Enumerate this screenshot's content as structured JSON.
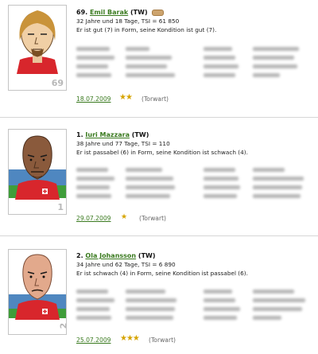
{
  "players": [
    {
      "rank": "69.",
      "name": "Emil Barak",
      "position_code": "(TW)",
      "age_tsi": "32 Jahre und 18 Tage, TSI = 61 850",
      "form_text": "Er ist gut (7) in Form, seine Kondition ist gut (7).",
      "shirt_number": "69",
      "date": "18.07.2009",
      "stars_icon": "star-rating-icon",
      "position_label": "(Torwart)"
    },
    {
      "rank": "1.",
      "name": "Iuri Mazzara",
      "position_code": "(TW)",
      "age_tsi": "38 Jahre und 77 Tage, TSI = 110",
      "form_text": "Er ist passabel (6) in Form, seine Kondition ist schwach (4).",
      "shirt_number": "1",
      "date": "29.07.2009",
      "stars_icon": "star-rating-icon",
      "position_label": "(Torwart)"
    },
    {
      "rank": "2.",
      "name": "Ola Johansson",
      "position_code": "(TW)",
      "age_tsi": "34 Jahre und 62 Tage, TSI = 6 890",
      "form_text": "Er ist schwach (4) in Form, seine Kondition ist passabel (6).",
      "shirt_number": "2",
      "date": "25.07.2009",
      "stars_icon": "star-rating-icon",
      "position_label": "(Torwart)"
    }
  ],
  "colors": {
    "link_green": "#3a7a1f",
    "star_gold": "#d6a400",
    "shirt_red": "#d8262c"
  }
}
